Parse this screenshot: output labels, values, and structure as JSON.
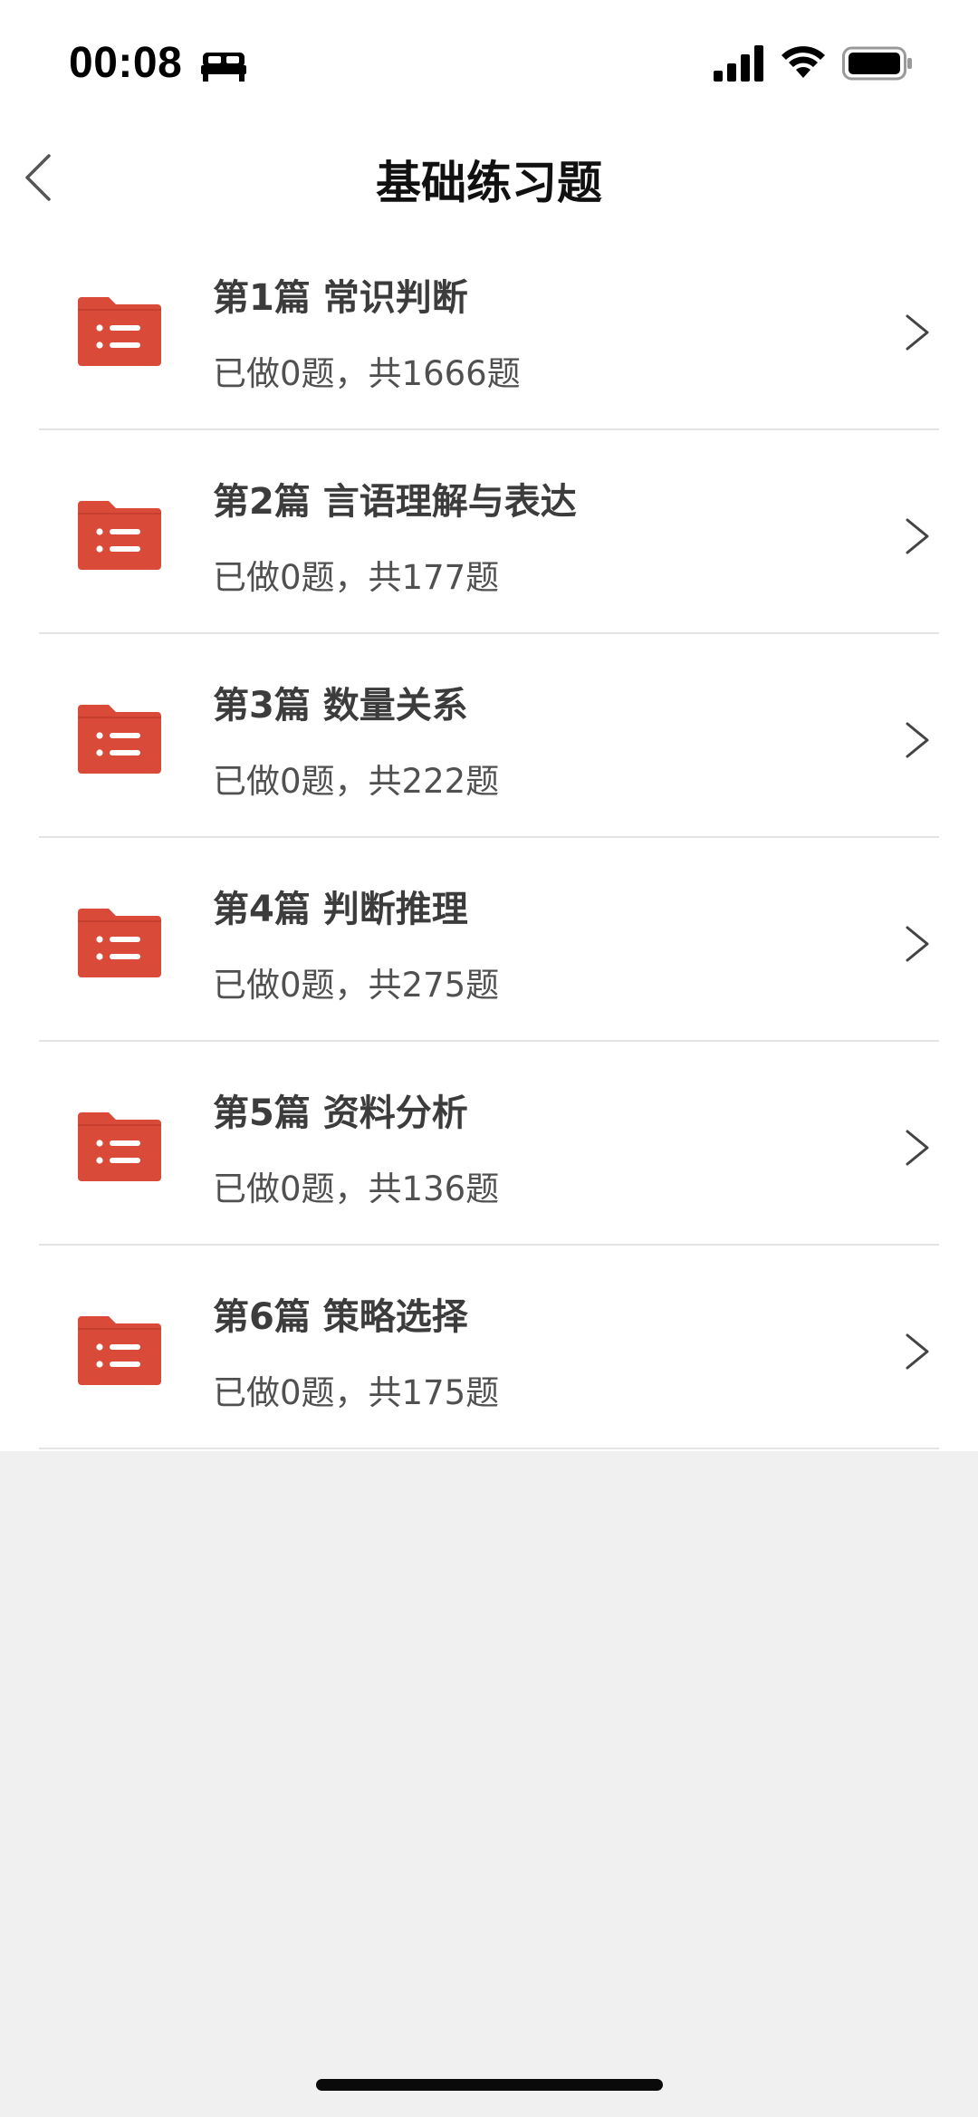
{
  "status_bar": {
    "time": "00:08",
    "icons": [
      "bed-icon",
      "signal-icon",
      "wifi-icon",
      "battery-icon"
    ]
  },
  "nav": {
    "title": "基础练习题",
    "back_icon": "chevron-left-icon"
  },
  "colors": {
    "folder": "#d94a38",
    "title_text": "#3c3c3c",
    "subtitle_text": "#505050",
    "background": "#f0f0f0",
    "divider": "#e4e4e4"
  },
  "sections": [
    {
      "title": "第1篇 常识判断",
      "progress": "已做0题，共1666题"
    },
    {
      "title": "第2篇 言语理解与表达",
      "progress": "已做0题，共177题"
    },
    {
      "title": "第3篇 数量关系",
      "progress": "已做0题，共222题"
    },
    {
      "title": "第4篇 判断推理",
      "progress": "已做0题，共275题"
    },
    {
      "title": "第5篇 资料分析",
      "progress": "已做0题，共136题"
    },
    {
      "title": "第6篇 策略选择",
      "progress": "已做0题，共175题"
    }
  ]
}
